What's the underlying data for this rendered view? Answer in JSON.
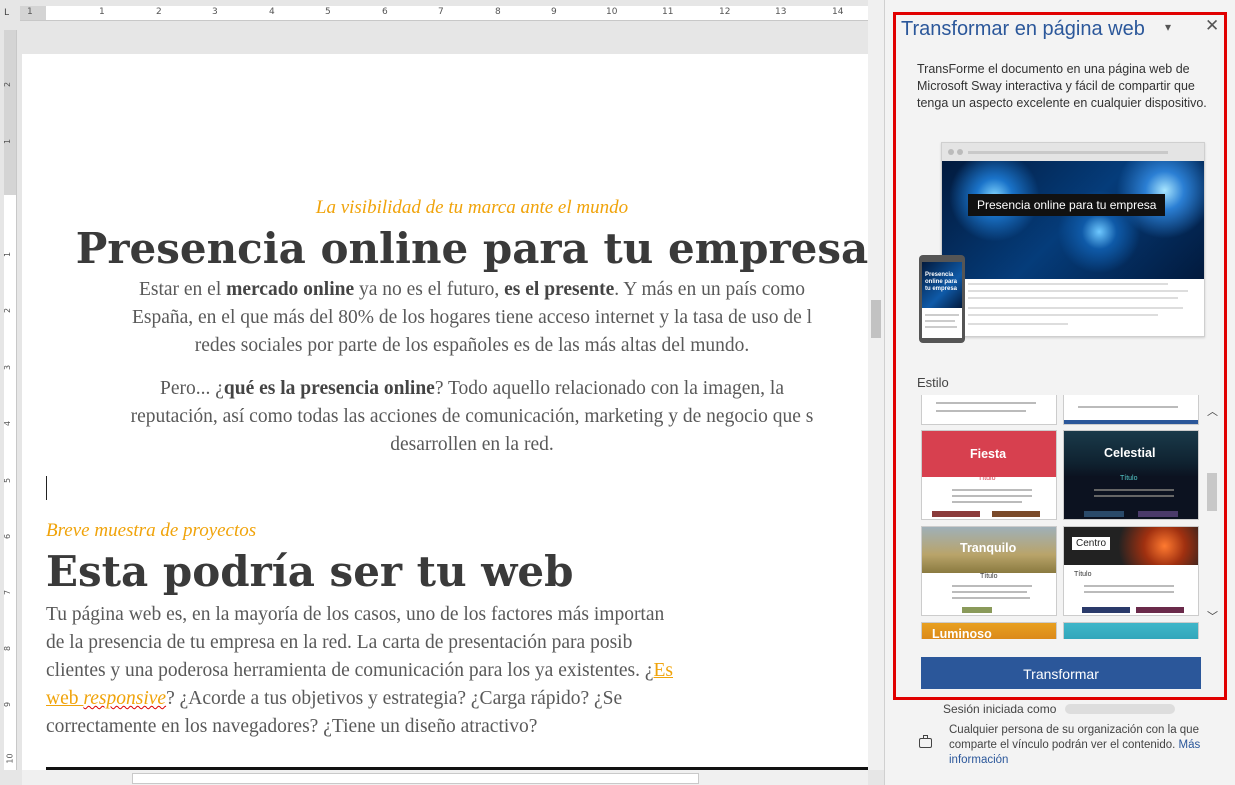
{
  "ruler": {
    "corner": "L",
    "h_numbers": [
      "1",
      "1",
      "2",
      "3",
      "4",
      "5",
      "6",
      "7",
      "8",
      "9",
      "10",
      "11",
      "12",
      "13",
      "14"
    ],
    "v_numbers": [
      "2",
      "1",
      "1",
      "2",
      "3",
      "4",
      "5",
      "6",
      "7",
      "8",
      "9",
      "10"
    ]
  },
  "document": {
    "section1": {
      "subtitle": "La visibilidad de tu marca ante el mundo",
      "title": "Presencia online para tu empresa",
      "p1": {
        "a": "Estar en el ",
        "b": "mercado online",
        "c": " ya no es el futuro, ",
        "d": "es el presente",
        "e": ". Y más en un país como",
        "line2": "España, en el que más del 80% de los hogares tiene acceso internet y la tasa de uso de l",
        "line3": "redes sociales por parte de los españoles es de las más altas del mundo."
      },
      "p2": {
        "a": "Pero... ¿",
        "b": "qué es la presencia online",
        "c": "? Todo aquello relacionado con la imagen, la",
        "line2": "reputación, así como todas las acciones de comunicación, marketing y de negocio que s",
        "line3": "desarrollen en la red."
      }
    },
    "section2": {
      "subtitle": "Breve muestra de proyectos",
      "title": "Esta podría ser tu web",
      "line1": "Tu página web es, en la mayoría de los casos, uno de los factores más importan",
      "line2": "de la presencia de tu empresa en la red. La carta de presentación para posib",
      "line3a": "clientes y una poderosa herramienta de comunicación para los ya existentes. ¿",
      "line3link": "Es",
      "line4link1": "web ",
      "line4link2": "responsive",
      "line4rest": "? ¿Acorde a tus objetivos y estrategia? ¿Carga rápido? ¿Se",
      "line5": "correctamente en los navegadores? ¿Tiene un diseño atractivo?"
    }
  },
  "pane": {
    "title": "Transformar en página web",
    "dropdown_glyph": "▾",
    "close_glyph": "✕",
    "description": "TransForme el documento en una página web de Microsoft Sway interactiva y fácil de compartir que tenga un aspecto excelente en cualquier dispositivo.",
    "preview_label": "Presencia online para tu empresa",
    "phone_label": "Presencia online para tu empresa",
    "style_label": "Estilo",
    "styles": [
      {
        "name": "Fiesta",
        "sub": "Título"
      },
      {
        "name": "Celestial",
        "sub": "Título"
      },
      {
        "name": "Tranquilo",
        "sub": "Título"
      },
      {
        "name": "Centro",
        "sub": "Título"
      },
      {
        "name": "Luminoso",
        "sub": ""
      }
    ],
    "scroll_up": "︿",
    "scroll_down": "﹀",
    "transform_button": "Transformar",
    "signed_in": "Sesión iniciada como",
    "share_text": "Cualquier persona de su organización con la que comparte el vínculo podrán ver el contenido. ",
    "more_info": "Más información"
  },
  "colors": {
    "accent": "#2b579a",
    "heading_orange": "#f0a30a",
    "highlight_frame": "#e00000"
  }
}
